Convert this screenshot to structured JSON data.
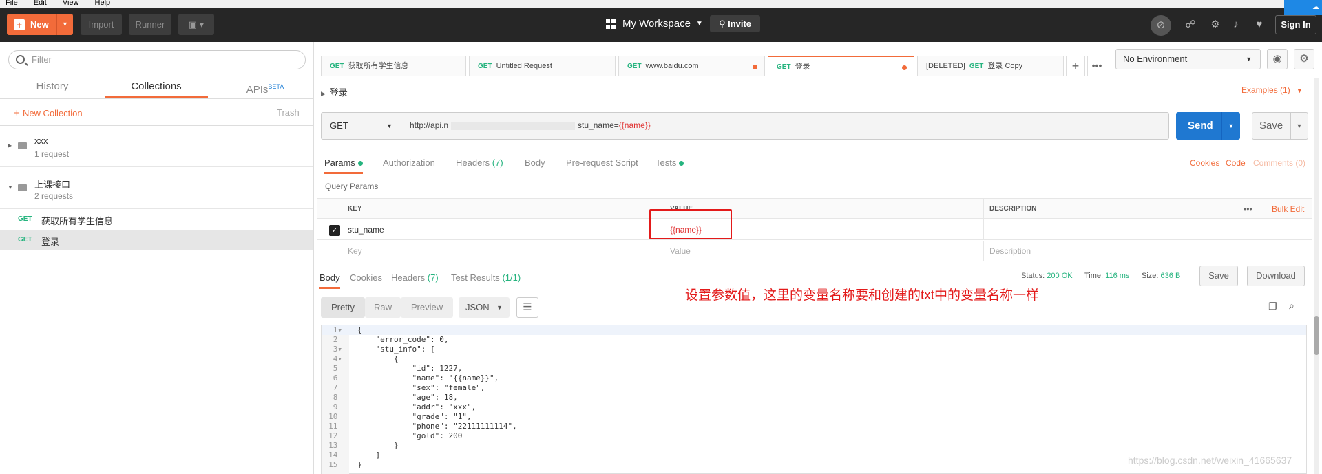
{
  "menubar": {
    "file": "File",
    "edit": "Edit",
    "view": "View",
    "help": "Help"
  },
  "header": {
    "new_label": "New",
    "import_label": "Import",
    "runner_label": "Runner",
    "workspace_label": "My Workspace",
    "invite_label": "Invite",
    "signin_label": "Sign In"
  },
  "sidebar": {
    "filter_placeholder": "Filter",
    "tabs": [
      {
        "label": "History"
      },
      {
        "label": "Collections"
      },
      {
        "label": "APIs",
        "badge": "BETA"
      }
    ],
    "new_collection_label": "New Collection",
    "trash_label": "Trash",
    "collections": [
      {
        "name": "xxx",
        "count": "1 request"
      },
      {
        "name": "上课接口",
        "count": "2 requests"
      }
    ],
    "requests": [
      {
        "method": "GET",
        "name": "获取所有学生信息"
      },
      {
        "method": "GET",
        "name": "登录"
      }
    ]
  },
  "request_tabs": [
    {
      "method": "GET",
      "name": "获取所有学生信息",
      "prefix": ""
    },
    {
      "method": "GET",
      "name": "Untitled Request",
      "prefix": ""
    },
    {
      "method": "GET",
      "name": "www.baidu.com",
      "prefix": ""
    },
    {
      "method": "GET",
      "name": "登录",
      "prefix": ""
    },
    {
      "method": "GET",
      "name": "登录 Copy",
      "prefix": "[DELETED]"
    }
  ],
  "environment": {
    "selected": "No Environment"
  },
  "request": {
    "title": "登录",
    "examples_label": "Examples (1)",
    "method": "GET",
    "url_start": "http://api.n",
    "url_end": "stu_name=",
    "url_var": "{{name}}",
    "send_label": "Send",
    "save_label": "Save"
  },
  "req_subtabs": {
    "params": "Params",
    "authorization": "Authorization",
    "headers": "Headers",
    "headers_count": "(7)",
    "body": "Body",
    "prerequest": "Pre-request Script",
    "tests": "Tests",
    "cookies": "Cookies",
    "code": "Code",
    "comments": "Comments (0)"
  },
  "query_params": {
    "title": "Query Params",
    "col_key": "KEY",
    "col_value": "VALUE",
    "col_desc": "DESCRIPTION",
    "bulk_edit": "Bulk Edit",
    "rows": [
      {
        "key": "stu_name",
        "value": "{{name}}",
        "checked": true
      }
    ],
    "key_placeholder": "Key",
    "value_placeholder": "Value",
    "desc_placeholder": "Description"
  },
  "response": {
    "tabs": {
      "body": "Body",
      "cookies": "Cookies",
      "headers": "Headers",
      "headers_count": "(7)",
      "tests": "Test Results",
      "tests_count": "(1/1)"
    },
    "status_label": "Status:",
    "status_value": "200 OK",
    "time_label": "Time:",
    "time_value": "116 ms",
    "size_label": "Size:",
    "size_value": "636 B",
    "save_label": "Save",
    "download_label": "Download",
    "formats": [
      "Pretty",
      "Raw",
      "Preview"
    ],
    "format_type": "JSON"
  },
  "annotation": "设置参数值，这里的变量名称要和创建的txt中的变量名称一样",
  "watermark": "https://blog.csdn.net/weixin_41665637",
  "code_lines": [
    "{",
    "    \"error_code\": 0,",
    "    \"stu_info\": [",
    "        {",
    "            \"id\": 1227,",
    "            \"name\": \"{{name}}\",",
    "            \"sex\": \"female\",",
    "            \"age\": 18,",
    "            \"addr\": \"xxx\",",
    "            \"grade\": \"1\",",
    "            \"phone\": \"22111111114\",",
    "            \"gold\": 200",
    "        }",
    "    ]",
    "}"
  ],
  "colors": {
    "accent": "#f26b3a",
    "send": "#1f78d1",
    "success": "#26b47f",
    "annotation": "#e31a1a"
  }
}
